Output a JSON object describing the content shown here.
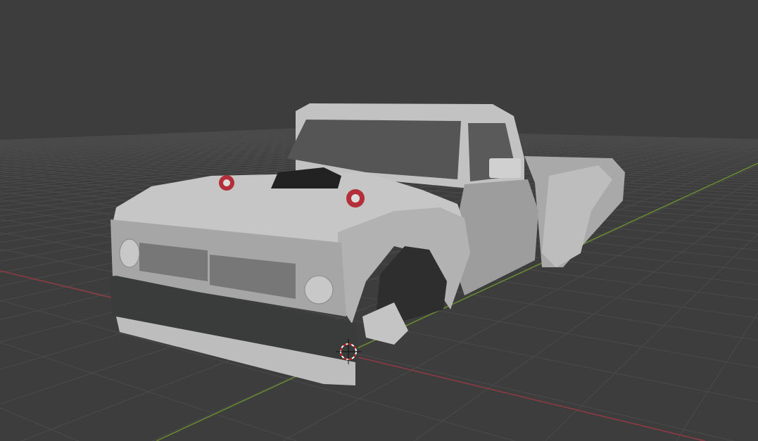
{
  "app": "3D viewport",
  "colors": {
    "background": "#3d3d3d",
    "grid": "#4a4a4a",
    "x_axis": "#8f3a44",
    "y_axis": "#6a8a2e",
    "body": "#b9b9b9",
    "body_shadow": "#8e8e8e",
    "bumper": "#3a3c3c",
    "turbo": "#b3303a"
  },
  "scene": {
    "object": "pickup-truck-model",
    "cursor": "3d-cursor"
  }
}
